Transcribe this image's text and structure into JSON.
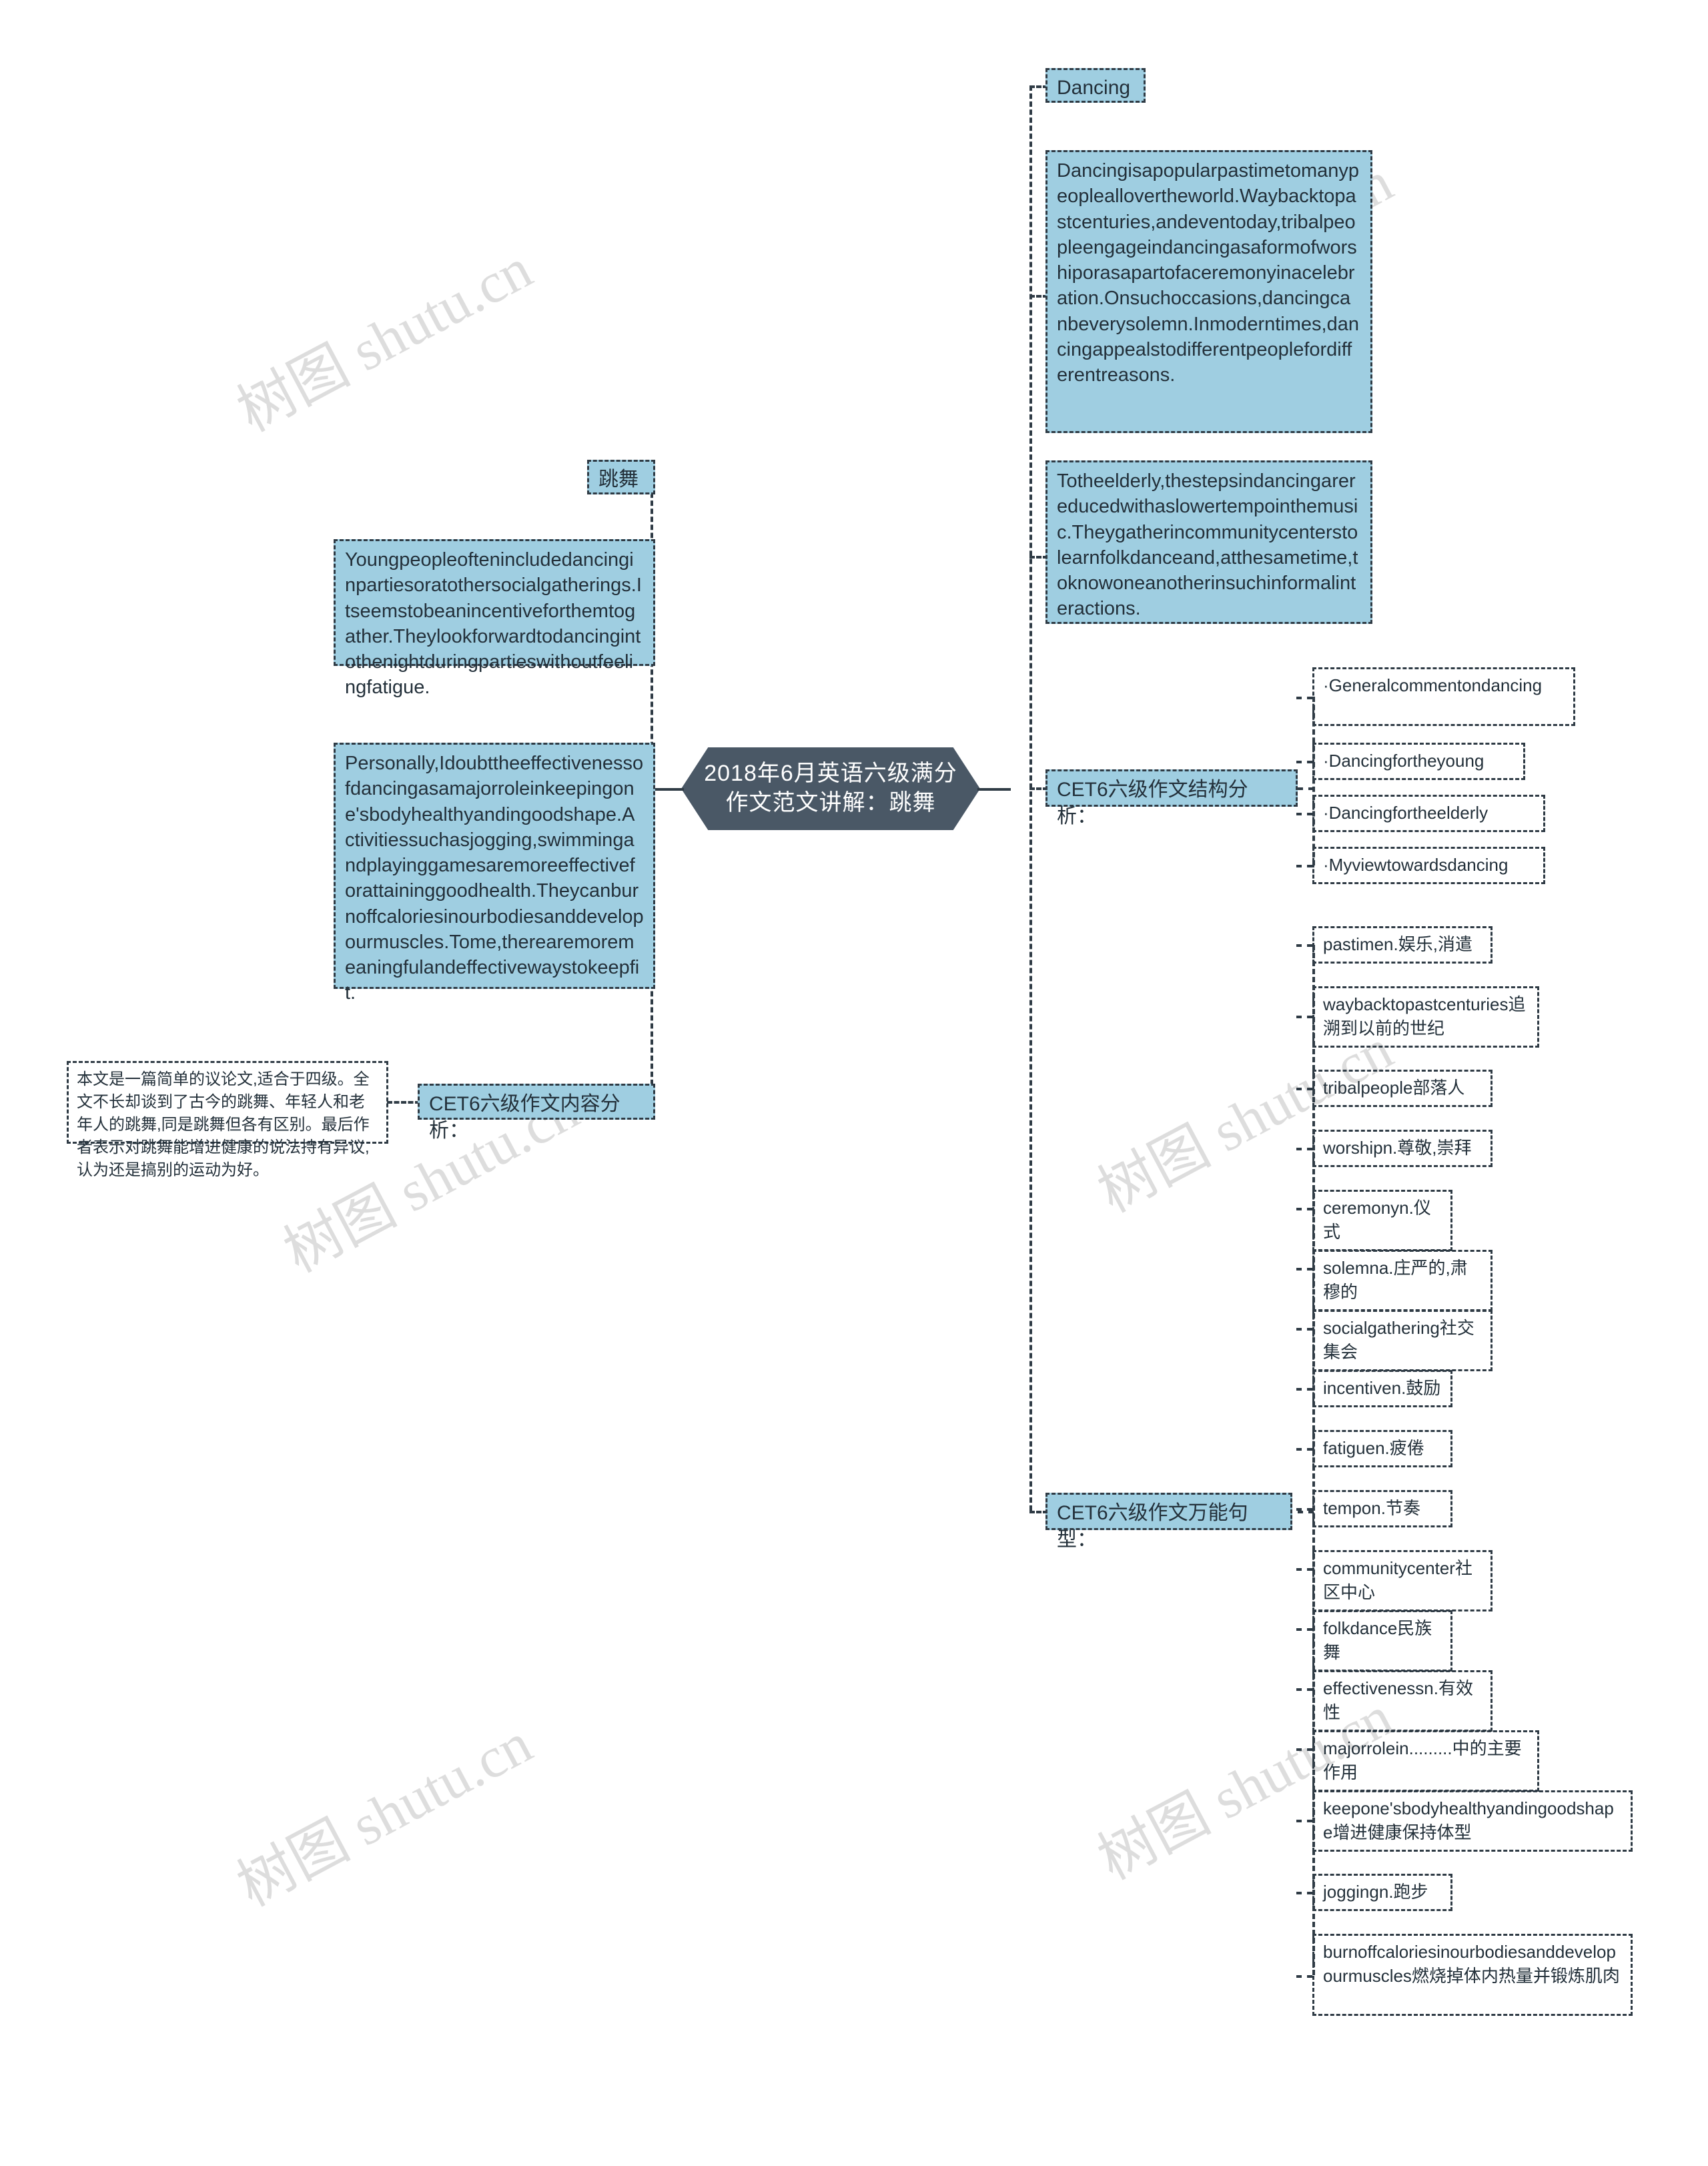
{
  "page": {
    "title": "2018年6月英语六级满分作文范文讲解：跳舞"
  },
  "watermarks": [
    "树图 shutu.cn",
    "树图 shutu.cn",
    "树图 shutu.cn",
    "树图 shutu.cn",
    "树图 shutu.cn",
    "树图 shutu.cn"
  ],
  "colors": {
    "node_fill": "#9fcee1",
    "node_border": "#2f3b45",
    "root_fill": "#4a5866",
    "root_text": "#ffffff",
    "text": "#23303a",
    "watermark": "#d8d8d8"
  },
  "root": {
    "label": "2018年6月英语六级满分作文范文讲解：跳舞"
  },
  "left_branch": {
    "title": {
      "label": "跳舞"
    },
    "paragraph_young": {
      "text": "Youngpeopleoftenincludedancinginpartiesoratothersocialgatherings.Itseemstobeanincentiveforthemtogather.Theylookforwardtodancingintothenightduringpartieswithoutfeelingfatigue."
    },
    "paragraph_personal": {
      "text": "Personally,Idoubttheeffectivenessofdancingasamajorroleinkeepingone'sbodyhealthyandingoodshape.Activitiessuchasjogging,swimmingandplayinggamesaremoreeffectiveforattaininggoodhealth.Theycanburnoffcaloriesinourbodiesanddevelopourmuscles.Tome,therearemoremeaningfulandeffectivewaystokeepfit."
    },
    "content_analysis": {
      "label": "CET6六级作文内容分析：",
      "note": "本文是一篇简单的议论文,适合于四级。全文不长却谈到了古今的跳舞、年轻人和老年人的跳舞,同是跳舞但各有区别。最后作者表示对跳舞能增进健康的说法持有异议,认为还是搞别的运动为好。"
    }
  },
  "right_branch": {
    "title": {
      "label": "Dancing"
    },
    "paragraph_general": {
      "text": "Dancingisapopularpastimetomanypeopleallovertheworld.Waybacktopastcenturies,andeventoday,tribalpeopleengageindancingasaformofworshiporasapartofaceremonyinacelebration.Onsuchoccasions,dancingcanbeverysolemn.Inmoderntimes,dancingappealstodifferentpeoplefordifferentreasons."
    },
    "paragraph_elderly": {
      "text": "Totheelderly,thestepsindancingarereducedwithaslowertempointhemusic.Theygatherincommunitycenterstolearnfolkdanceand,atthesametime,toknowoneanotherinsuchinformalinteractions."
    },
    "structure_analysis": {
      "label": "CET6六级作文结构分析：",
      "items": [
        "·Generalcommentondancing",
        "·Dancingfortheyoung",
        "·Dancingfortheelderly",
        "·Myviewtowardsdancing"
      ]
    },
    "sentence_patterns": {
      "label": "CET6六级作文万能句型：",
      "items": [
        "pastimen.娱乐,消遣",
        "waybacktopastcenturies追溯到以前的世纪",
        "tribalpeople部落人",
        "worshipn.尊敬,崇拜",
        "ceremonyn.仪式",
        "solemna.庄严的,肃穆的",
        "socialgathering社交集会",
        "incentiven.鼓励",
        "fatiguen.疲倦",
        "tempon.节奏",
        "communitycenter社区中心",
        "folkdance民族舞",
        "effectivenessn.有效性",
        "majorrolein.........中的主要作用",
        "keepone'sbodyhealthyandingoodshape增进健康保持体型",
        "joggingn.跑步",
        "burnoffcaloriesinourbodiesanddevelopourmuscles燃烧掉体内热量并锻炼肌肉"
      ]
    }
  }
}
